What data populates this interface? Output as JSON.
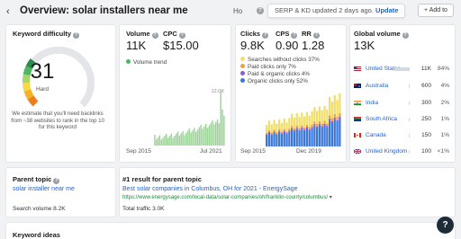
{
  "header": {
    "back_icon": "chevron-left",
    "title": "Overview: solar installers near me",
    "truncated_label": "Ho",
    "tooltip_text": "SERP & KD updated 2 days ago.",
    "tooltip_link": "Update",
    "add_to_label": "+ Add to"
  },
  "kd": {
    "title": "Keyword difficulty",
    "value": "31",
    "label": "Hard",
    "note": "We estimate that you'll need backlinks from ~38 websites to rank in the top 10 for this keyword",
    "level": 31,
    "colors": [
      "#f07b1b",
      "#f5b324",
      "#f6d94a",
      "#a6d66a",
      "#4fb663",
      "#2a8d4e"
    ]
  },
  "volume": {
    "title": "Volume",
    "value": "11K",
    "cpc_title": "CPC",
    "cpc_value": "$15.00",
    "legend": "Volume trend",
    "range_start": "Sep 2015",
    "range_end": "Jul 2021",
    "ymax_label": "12.0K",
    "color": "#4fb663"
  },
  "clicks": {
    "title": "Clicks",
    "value": "9.8K",
    "cps_title": "CPS",
    "cps_value": "0.90",
    "rr_title": "RR",
    "rr_value": "1.28",
    "legend": [
      {
        "label": "Searches without clicks 37%",
        "color": "#f2df6b"
      },
      {
        "label": "Paid clicks only 7%",
        "color": "#f0a13a"
      },
      {
        "label": "Paid & organic clicks 4%",
        "color": "#8a5bd6"
      },
      {
        "label": "Organic clicks only 52%",
        "color": "#3c78d8"
      }
    ],
    "range_start": "Sep 2015",
    "range_end": "Dec 2019"
  },
  "global": {
    "title": "Global volume",
    "value": "13K",
    "rows": [
      {
        "flag": "us",
        "country": "United States",
        "volume": "11K",
        "pct": "84%",
        "share": 0.84
      },
      {
        "flag": "au",
        "country": "Australia",
        "volume": "600",
        "pct": "4%",
        "share": 0.04
      },
      {
        "flag": "in",
        "country": "India",
        "volume": "300",
        "pct": "2%",
        "share": 0.02
      },
      {
        "flag": "za",
        "country": "South Africa",
        "volume": "250",
        "pct": "1%",
        "share": 0.01
      },
      {
        "flag": "ca",
        "country": "Canada",
        "volume": "150",
        "pct": "1%",
        "share": 0.01
      },
      {
        "flag": "gb",
        "country": "United Kingdom",
        "volume": "100",
        "pct": "<1%",
        "share": 0.008
      }
    ]
  },
  "parent": {
    "title": "Parent topic",
    "topic": "solar installer near me",
    "search_volume": "Search volume 8.2K"
  },
  "result": {
    "title": "#1 result for parent topic",
    "link_text": "Best solar companies in Columbus, OH for 2021 - EnergySage",
    "url": "https://www.energysage.com/local-data/solar-companies/oh/franklin-county/columbus/",
    "traffic": "Total traffic 3.0K"
  },
  "bottom": {
    "keyword_ideas": "Keyword ideas"
  },
  "help_label": "?"
}
